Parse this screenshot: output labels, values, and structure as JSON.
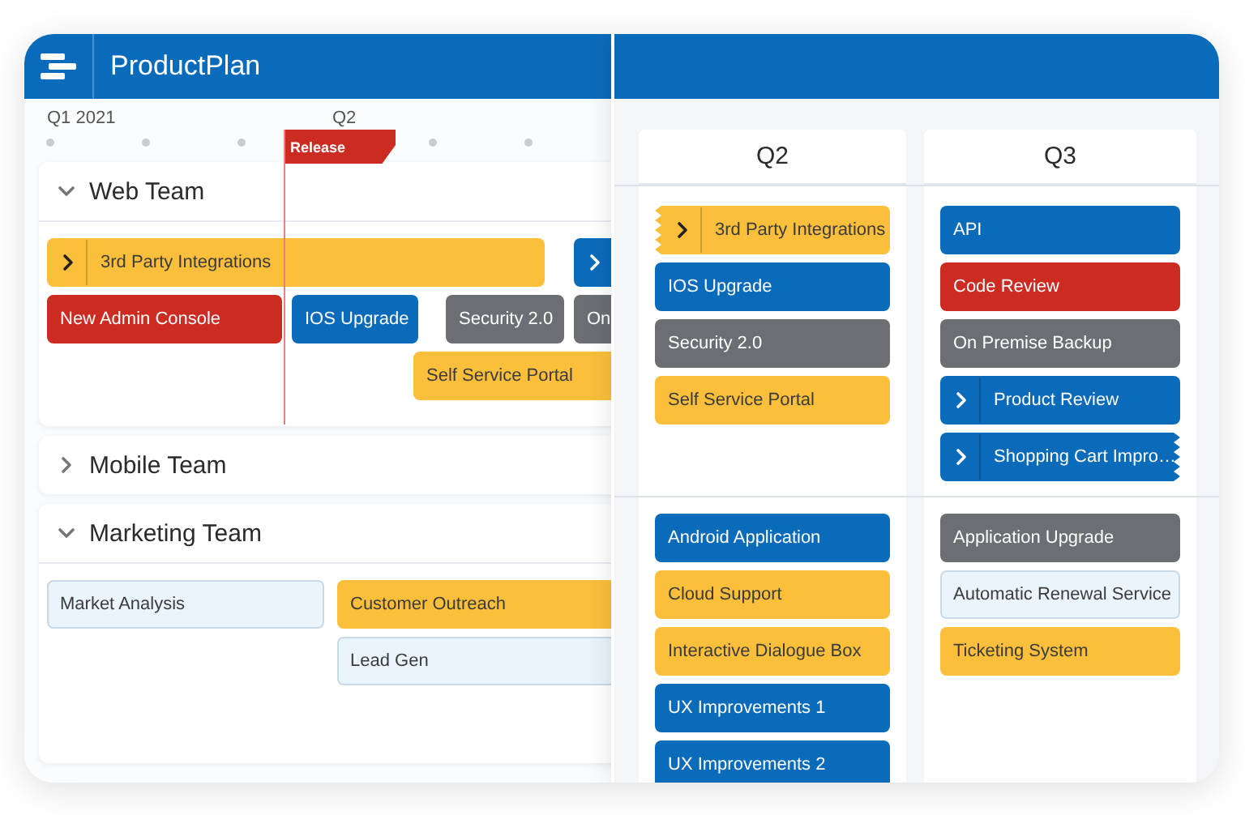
{
  "app": {
    "title": "ProductPlan"
  },
  "timeline": {
    "axis": [
      {
        "label": "Q1 2021"
      },
      {
        "label": "Q2"
      }
    ],
    "marker": {
      "label": "Release"
    },
    "lanes": [
      {
        "name": "Web Team",
        "expanded": true,
        "bars": [
          {
            "label": "3rd Party Integrations",
            "color": "#fbbf3b",
            "has_children": true
          },
          {
            "color": "#0b6bbb",
            "has_children": true
          },
          {
            "label": "New Admin Console",
            "color": "#cc2b22",
            "has_children": false
          },
          {
            "label": "IOS Upgrade",
            "color": "#0b6bbb",
            "has_children": false
          },
          {
            "label": "Security 2.0",
            "color": "#6b6e72",
            "has_children": false
          },
          {
            "label": "On",
            "color": "#6b6e72",
            "has_children": false
          },
          {
            "label": "Self Service Portal",
            "color": "#fbbf3b",
            "has_children": false
          }
        ]
      },
      {
        "name": "Mobile Team",
        "expanded": false
      },
      {
        "name": "Marketing Team",
        "expanded": true,
        "bars": [
          {
            "label": "Market Analysis",
            "color": "#eaf4fd",
            "has_children": false
          },
          {
            "label": "Customer Outreach",
            "color": "#fbbf3b",
            "has_children": false
          },
          {
            "label": "Lead Gen",
            "color": "#eaf4fd",
            "has_children": false
          }
        ]
      }
    ]
  },
  "board": {
    "columns": [
      {
        "title": "Q2"
      },
      {
        "title": "Q3"
      }
    ],
    "lanes": [
      {
        "columns": [
          [
            {
              "label": "3rd Party Integrations",
              "color": "#fbbf3b",
              "has_children": true,
              "continues_before": true,
              "continues_after": false
            },
            {
              "label": "IOS Upgrade",
              "color": "#0b6bbb",
              "has_children": false,
              "continues_before": false,
              "continues_after": false
            },
            {
              "label": "Security 2.0",
              "color": "#6b6e72",
              "has_children": false,
              "continues_before": false,
              "continues_after": false
            },
            {
              "label": "Self Service Portal",
              "color": "#fbbf3b",
              "has_children": false,
              "continues_before": false,
              "continues_after": false
            }
          ],
          [
            {
              "label": "API",
              "color": "#0b6bbb",
              "has_children": false,
              "continues_before": false,
              "continues_after": false
            },
            {
              "label": "Code Review",
              "color": "#cc2b22",
              "has_children": false,
              "continues_before": false,
              "continues_after": false
            },
            {
              "label": "On Premise Backup",
              "color": "#6b6e72",
              "has_children": false,
              "continues_before": false,
              "continues_after": false
            },
            {
              "label": "Product Review",
              "color": "#0b6bbb",
              "has_children": true,
              "continues_before": false,
              "continues_after": false
            },
            {
              "label": "Shopping Cart Impro…",
              "color": "#0b6bbb",
              "has_children": true,
              "continues_before": false,
              "continues_after": true
            }
          ]
        ]
      },
      {
        "columns": [
          [
            {
              "label": "Android Application",
              "color": "#0b6bbb",
              "has_children": false,
              "continues_before": false,
              "continues_after": false
            },
            {
              "label": "Cloud Support",
              "color": "#fbbf3b",
              "has_children": false,
              "continues_before": false,
              "continues_after": false
            },
            {
              "label": "Interactive Dialogue Box",
              "color": "#fbbf3b",
              "has_children": false,
              "continues_before": false,
              "continues_after": false
            },
            {
              "label": "UX Improvements 1",
              "color": "#0b6bbb",
              "has_children": false,
              "continues_before": false,
              "continues_after": false
            },
            {
              "label": "UX Improvements 2",
              "color": "#0b6bbb",
              "has_children": false,
              "continues_before": false,
              "continues_after": false
            }
          ],
          [
            {
              "label": "Application Upgrade",
              "color": "#6b6e72",
              "has_children": false,
              "continues_before": false,
              "continues_after": false
            },
            {
              "label": "Automatic Renewal Service",
              "color": "#eaf4fd",
              "has_children": false,
              "continues_before": false,
              "continues_after": false
            },
            {
              "label": "Ticketing System",
              "color": "#fbbf3b",
              "has_children": false,
              "continues_before": false,
              "continues_after": false
            }
          ]
        ]
      }
    ]
  }
}
